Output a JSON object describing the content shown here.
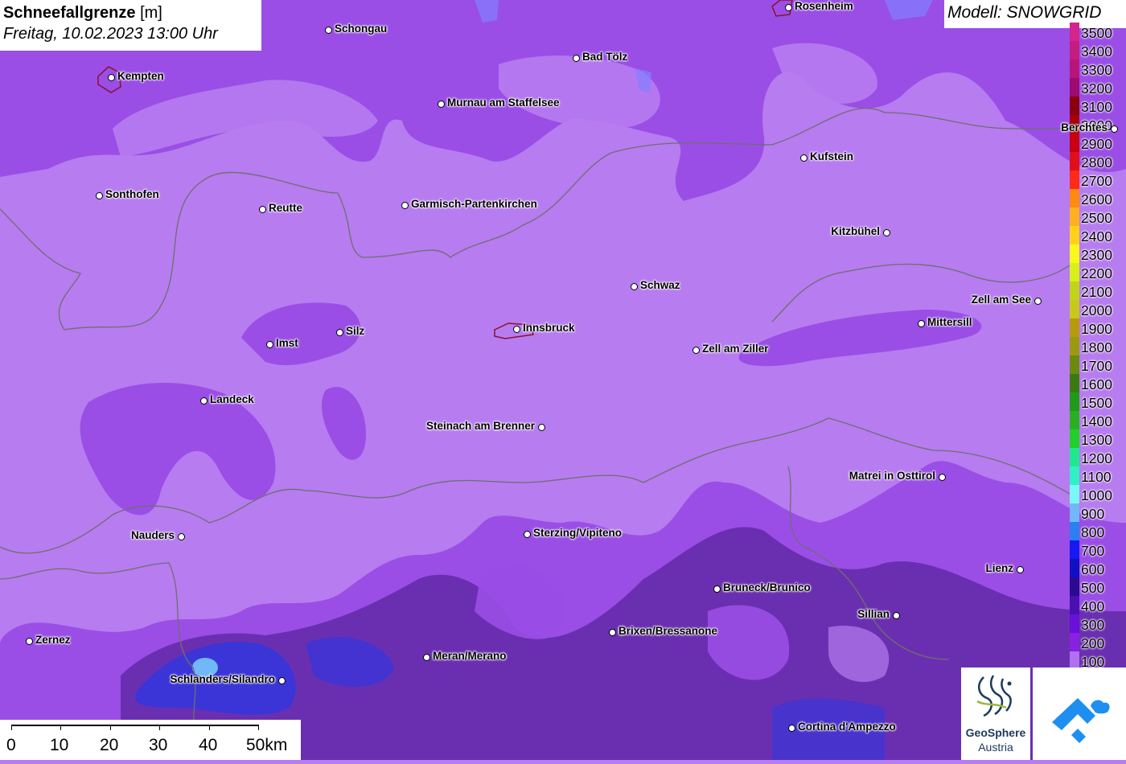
{
  "title": {
    "variable": "Schneefallgrenze",
    "unit": "[m]",
    "datetime": "Freitag, 10.02.2023 13:00 Uhr"
  },
  "model_label": "Modell: SNOWGRID",
  "colors": {
    "background": "#b77cf0",
    "light_band": "#c38ff5",
    "mid_band": "#9a4ee6",
    "dark_band": "#6a2fb0",
    "blue_band": "#3b35d8",
    "border": "#6e6e6e"
  },
  "legend": [
    {
      "label": "3500",
      "color": "#d4258c"
    },
    {
      "label": "3400",
      "color": "#c41d80"
    },
    {
      "label": "3300",
      "color": "#b8157a"
    },
    {
      "label": "3200",
      "color": "#9c0a72"
    },
    {
      "label": "3100",
      "color": "#8a0010"
    },
    {
      "label": "3000",
      "color": "#a80008"
    },
    {
      "label": "2900",
      "color": "#c80010"
    },
    {
      "label": "2800",
      "color": "#e0101a"
    },
    {
      "label": "2700",
      "color": "#ff2a1a"
    },
    {
      "label": "2600",
      "color": "#ff8a10"
    },
    {
      "label": "2500",
      "color": "#ffb020"
    },
    {
      "label": "2400",
      "color": "#ffd21a"
    },
    {
      "label": "2300",
      "color": "#f8f81a"
    },
    {
      "label": "2200",
      "color": "#d8f01a"
    },
    {
      "label": "2100",
      "color": "#c0d41a"
    },
    {
      "label": "2000",
      "color": "#c8c81a"
    },
    {
      "label": "1900",
      "color": "#b89a10"
    },
    {
      "label": "1800",
      "color": "#9a9a10"
    },
    {
      "label": "1700",
      "color": "#6a8a10"
    },
    {
      "label": "1600",
      "color": "#3a7a10"
    },
    {
      "label": "1500",
      "color": "#209a18"
    },
    {
      "label": "1400",
      "color": "#28b020"
    },
    {
      "label": "1300",
      "color": "#20d028"
    },
    {
      "label": "1200",
      "color": "#20e890"
    },
    {
      "label": "1100",
      "color": "#30f0c8"
    },
    {
      "label": "1000",
      "color": "#7af8f8"
    },
    {
      "label": "900",
      "color": "#70b8f8"
    },
    {
      "label": "800",
      "color": "#2a80f0"
    },
    {
      "label": "700",
      "color": "#1818f0"
    },
    {
      "label": "600",
      "color": "#1010c0"
    },
    {
      "label": "500",
      "color": "#2a0a90"
    },
    {
      "label": "400",
      "color": "#4a10b0"
    },
    {
      "label": "300",
      "color": "#6a10d8"
    },
    {
      "label": "200",
      "color": "#8a20e0"
    },
    {
      "label": "100",
      "color": "#b070f0"
    }
  ],
  "scale_bar": {
    "labels": [
      "0",
      "10",
      "20",
      "30",
      "40",
      "50km"
    ]
  },
  "cities": [
    {
      "name": "Rosenheim"
    },
    {
      "name": "Schongau"
    },
    {
      "name": "Kempten"
    },
    {
      "name": "Bad Tölz"
    },
    {
      "name": "Murnau am Staffelsee"
    },
    {
      "name": "Berchtes"
    },
    {
      "name": "Kufstein"
    },
    {
      "name": "Sonthofen"
    },
    {
      "name": "Reutte"
    },
    {
      "name": "Garmisch-Partenkirchen"
    },
    {
      "name": "Kitzbühel"
    },
    {
      "name": "Schwaz"
    },
    {
      "name": "Zell am See"
    },
    {
      "name": "Silz"
    },
    {
      "name": "Innsbruck"
    },
    {
      "name": "Mittersill"
    },
    {
      "name": "Imst"
    },
    {
      "name": "Zell am Ziller"
    },
    {
      "name": "Landeck"
    },
    {
      "name": "Steinach am Brenner"
    },
    {
      "name": "Matrei in Osttirol"
    },
    {
      "name": "Nauders"
    },
    {
      "name": "Sterzing/Vipiteno"
    },
    {
      "name": "Lienz"
    },
    {
      "name": "Bruneck/Brunico"
    },
    {
      "name": "Sillian"
    },
    {
      "name": "Brixen/Bressanone"
    },
    {
      "name": "Zernez"
    },
    {
      "name": "Meran/Merano"
    },
    {
      "name": "Schlanders/Silandro"
    },
    {
      "name": "Cortina d'Ampezzo"
    }
  ],
  "logos": {
    "geosphere_name": "GeoSphere",
    "geosphere_sub": "Austria"
  }
}
